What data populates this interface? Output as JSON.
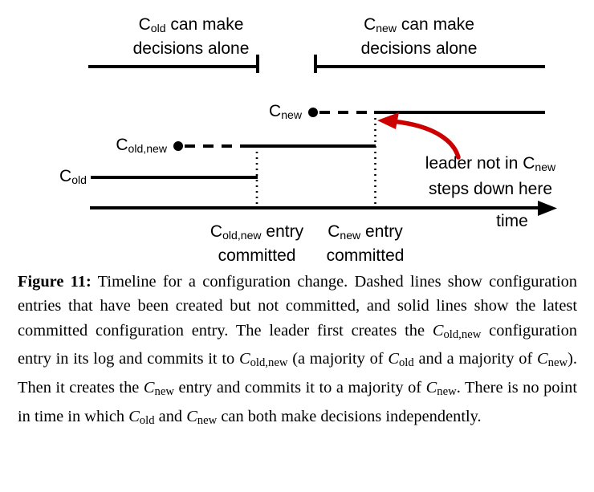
{
  "figure": {
    "brackets": {
      "left": {
        "label_line1": "C",
        "label_line1_sub": "old",
        "label_line1_rest": " can make",
        "label_line2": "decisions alone"
      },
      "right": {
        "label_line1": "C",
        "label_line1_sub": "new",
        "label_line1_rest": " can make",
        "label_line2": "decisions alone"
      }
    },
    "series": [
      {
        "name": "c-new",
        "label": "C",
        "label_sub": "new"
      },
      {
        "name": "c-old-new",
        "label": "C",
        "label_sub": "old,new"
      },
      {
        "name": "c-old",
        "label": "C",
        "label_sub": "old"
      }
    ],
    "annotation": {
      "line1_pre": "leader not in C",
      "line1_sub": "new",
      "line2": "steps down here",
      "color": "#CC0000"
    },
    "axis": {
      "label": "time"
    },
    "event_markers": [
      {
        "name": "c-old-new-committed",
        "line1_pre": "C",
        "line1_sub": "old,new",
        "line1_post": " entry",
        "line2": "committed"
      },
      {
        "name": "c-new-committed",
        "line1_pre": "C",
        "line1_sub": "new",
        "line1_post": " entry",
        "line2": "committed"
      }
    ],
    "colors": {
      "ink": "#000000",
      "accent": "#CC0000",
      "background": "#FFFFFF"
    }
  },
  "caption": {
    "label": "Figure 11:",
    "p1": " Timeline for a configuration change. Dashed lines show configuration entries that have been created but not committed, and solid lines show the latest committed configuration entry. The leader first creates the ",
    "v1": "C",
    "v1sub": "old,new",
    "p2": " configuration entry in its log and commits it to ",
    "v2": "C",
    "v2sub": "old,new",
    "p3": " (a majority of ",
    "v3": "C",
    "v3sub": "old",
    "p4": " and a majority of ",
    "v4": "C",
    "v4sub": "new",
    "p5": "). Then it creates the ",
    "v5": "C",
    "v5sub": "new",
    "p6": " entry and commits it to a majority of ",
    "v6": "C",
    "v6sub": "new",
    "p7": ". There is no point in time in which ",
    "v7": "C",
    "v7sub": "old",
    "p8": " and ",
    "v8": "C",
    "v8sub": "new",
    "p9": " can both make decisions independently."
  }
}
